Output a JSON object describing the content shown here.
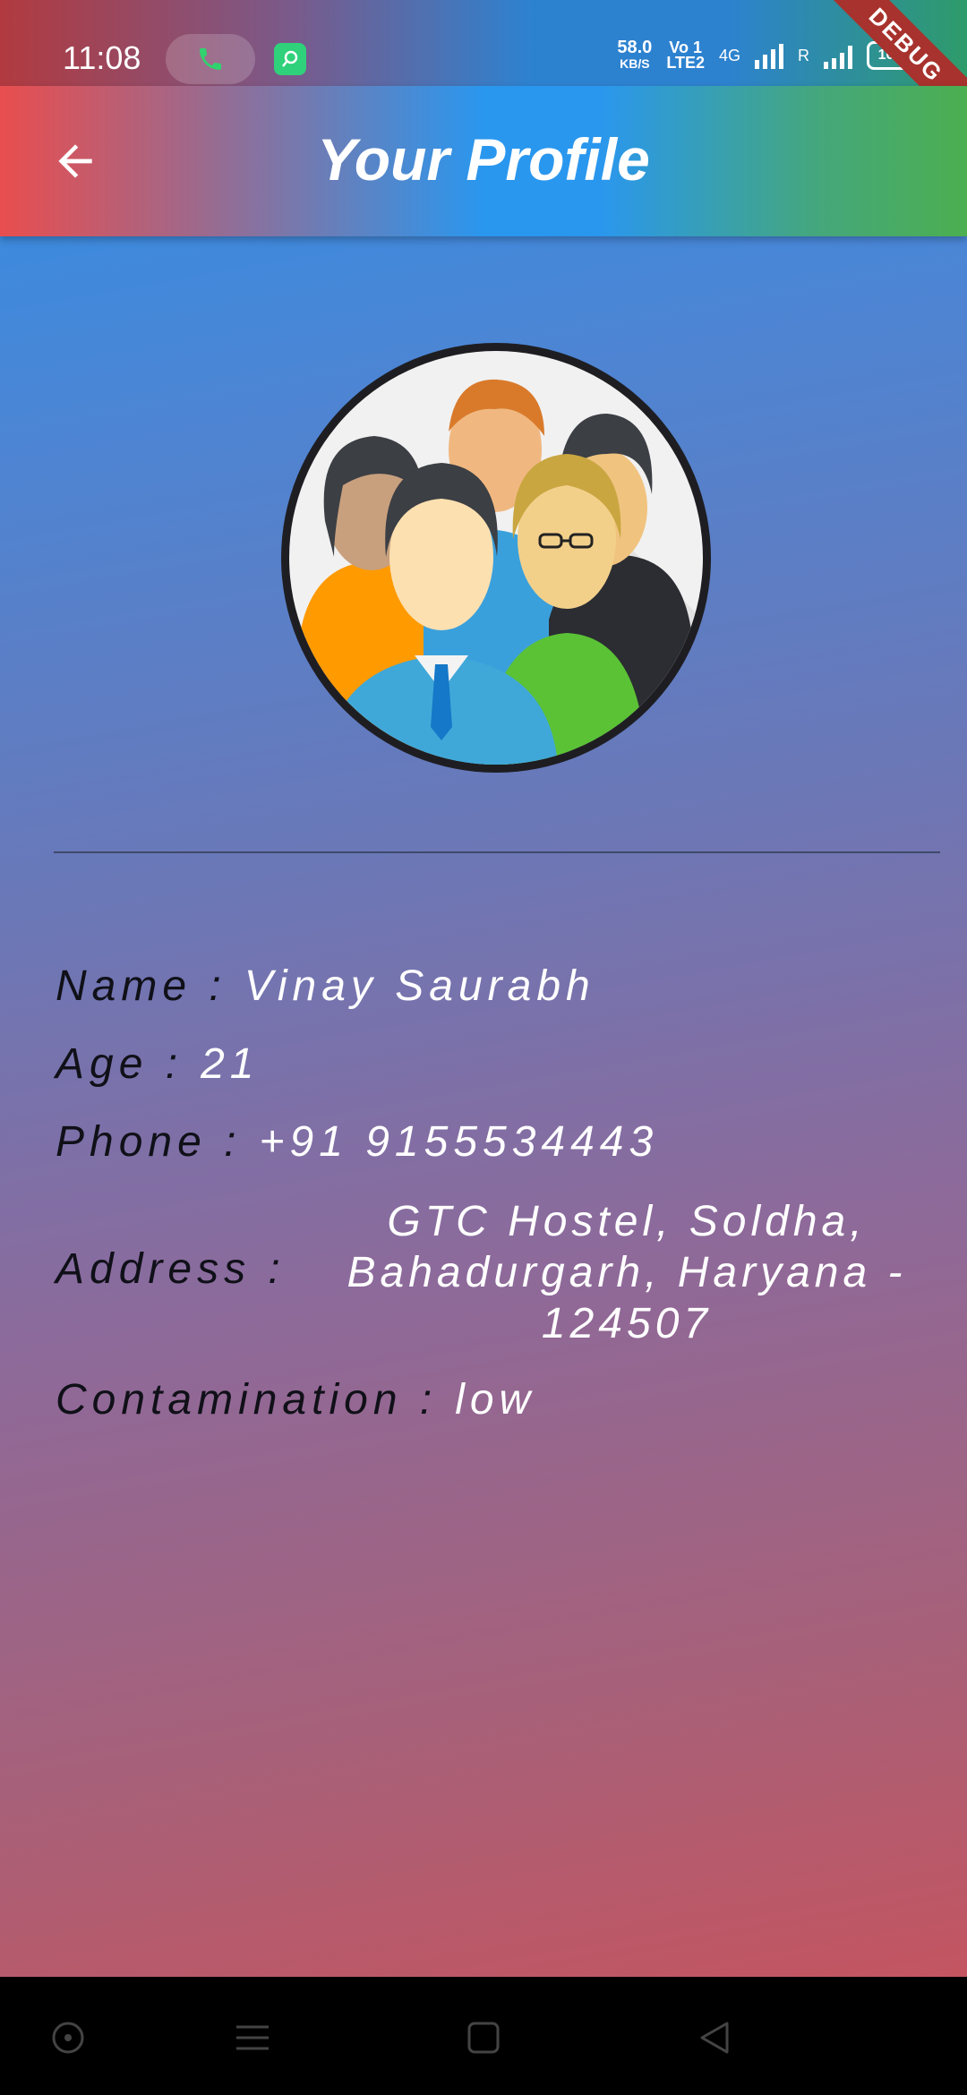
{
  "status_bar": {
    "time": "11:08",
    "net_speed": "58.0",
    "net_unit": "KB/S",
    "volte_top": "Vo 1",
    "volte_bottom": "LTE2",
    "network": "4G",
    "roaming": "R",
    "battery": "100"
  },
  "debug_banner": "DEBUG",
  "app_bar": {
    "title": "Your Profile"
  },
  "profile": {
    "name_label": "Name :",
    "name_value": "Vinay Saurabh",
    "age_label": "Age :",
    "age_value": "21",
    "phone_label": "Phone :",
    "phone_value": "+91 9155534443",
    "address_label": "Address :",
    "address_line1": "GTC Hostel, Soldha,",
    "address_line2": "Bahadurgarh, Haryana -",
    "address_line3": "124507",
    "contamination_label": "Contamination :",
    "contamination_value": "low"
  },
  "icons": {
    "back": "arrow-left-icon",
    "avatar": "group-avatar-icon",
    "nav_assist": "circle-dot-icon",
    "nav_menu": "menu-lines-icon",
    "nav_home": "square-icon",
    "nav_back": "triangle-back-icon"
  }
}
